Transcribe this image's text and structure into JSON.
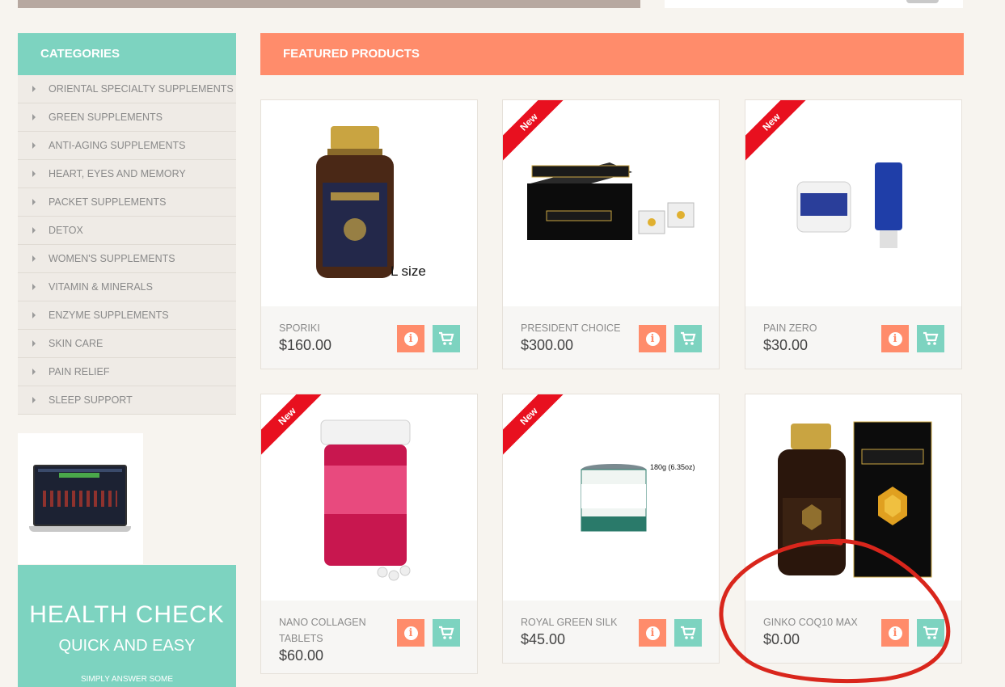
{
  "sidebar": {
    "title": "CATEGORIES",
    "items": [
      {
        "label": "ORIENTAL SPECIALTY SUPPLEMENTS"
      },
      {
        "label": "GREEN SUPPLEMENTS"
      },
      {
        "label": "ANTI-AGING SUPPLEMENTS"
      },
      {
        "label": "HEART, EYES AND MEMORY"
      },
      {
        "label": "PACKET SUPPLEMENTS"
      },
      {
        "label": "DETOX"
      },
      {
        "label": "WOMEN'S SUPPLEMENTS"
      },
      {
        "label": "VITAMIN & MINERALS"
      },
      {
        "label": "ENZYME SUPPLEMENTS"
      },
      {
        "label": "SKIN CARE"
      },
      {
        "label": "PAIN RELIEF"
      },
      {
        "label": "SLEEP SUPPORT"
      }
    ],
    "health": {
      "title": "HEALTH CHECK",
      "subtitle": "QUICK AND EASY",
      "note": "SIMPLY ANSWER SOME"
    }
  },
  "featured": {
    "title": "FEATURED PRODUCTS",
    "products": [
      {
        "name": "SPORIKI",
        "price": "$160.00",
        "badge": "",
        "image_caption": "L size",
        "icons": [
          "info-icon",
          "cart-icon"
        ]
      },
      {
        "name": "PRESIDENT CHOICE",
        "price": "$300.00",
        "badge": "New",
        "image_caption": "",
        "icons": [
          "info-icon",
          "cart-icon"
        ]
      },
      {
        "name": "PAIN ZERO",
        "price": "$30.00",
        "badge": "New",
        "image_caption": "",
        "icons": [
          "info-icon",
          "cart-icon"
        ]
      },
      {
        "name": "NANO COLLAGEN TABLETS",
        "price": "$60.00",
        "badge": "New",
        "image_caption": "",
        "icons": [
          "info-icon",
          "cart-icon"
        ]
      },
      {
        "name": "ROYAL GREEN SILK",
        "price": "$45.00",
        "badge": "New",
        "image_caption": "180g (6.35oz)",
        "icons": [
          "info-icon",
          "cart-icon"
        ]
      },
      {
        "name": "GINKO COQ10 MAX",
        "price": "$0.00",
        "badge": "",
        "image_caption": "",
        "icons": [
          "info-icon",
          "cart-icon"
        ]
      }
    ]
  },
  "colors": {
    "teal": "#7dd3c0",
    "coral": "#ff8c6b",
    "ribbon_red": "#e8101f",
    "annotation_red": "#d9261c"
  }
}
